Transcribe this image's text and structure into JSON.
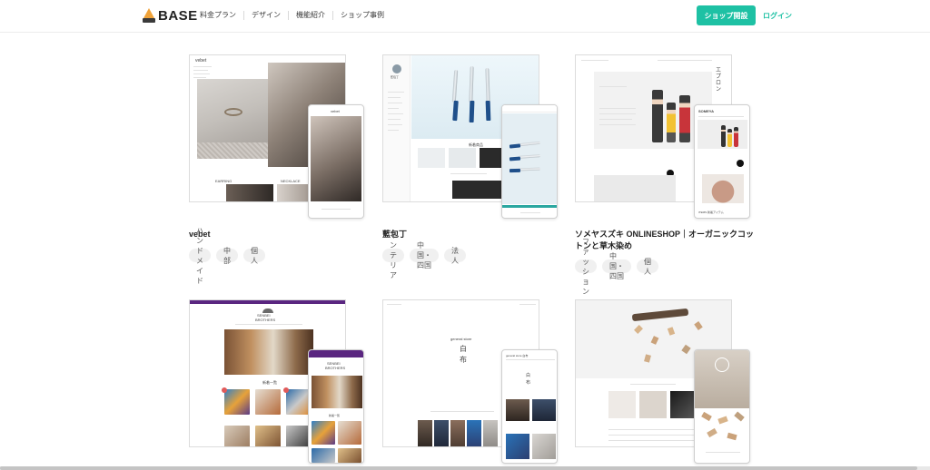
{
  "header": {
    "logo_text": "BASE",
    "nav": [
      "料金プラン",
      "デザイン",
      "機能紹介",
      "ショップ事例"
    ],
    "open_shop_label": "ショップ開設",
    "login_label": "ログイン"
  },
  "colors": {
    "accent": "#1ec1a4",
    "tag_bg": "#f0f0f0",
    "border": "#dcdcdc"
  },
  "shops": [
    {
      "title": "vebet",
      "tags": [
        "ハンドメイド",
        "中部",
        "個人"
      ],
      "desk_brand": "vebet",
      "desk_captions": [
        "EARRING",
        "NECKLACE"
      ],
      "phone_brand": "vebet"
    },
    {
      "title": "藍包丁",
      "tags": [
        "インテリア",
        "中国・四国",
        "法人"
      ],
      "desk_brand": "藍包丁",
      "desk_section": "新着商品"
    },
    {
      "title": "ソメヤスズキ ONLINESHOP｜オーガニックコットンと草木染め",
      "tags": [
        "ファッション",
        "中国・四国",
        "個人"
      ],
      "desk_vertical_text": "エプロン",
      "phone_brand": "SOMEYA",
      "phone_caption": "ITEMS 新着アイテム"
    },
    {
      "title": "",
      "tags": [],
      "desk_brand_line1": "SENBEI",
      "desk_brand_line2": "BROTHERS",
      "desk_section": "新着一覧",
      "phone_section": "新着一覧"
    },
    {
      "title": "",
      "tags": [],
      "desk_brand": "general store",
      "desk_kanji": [
        "白",
        "布"
      ],
      "phone_brand": "general store 白布"
    },
    {
      "title": "",
      "tags": [],
      "desk_brand": "",
      "phone_caption": ""
    }
  ],
  "scrollbar": {
    "position": "bottom"
  }
}
